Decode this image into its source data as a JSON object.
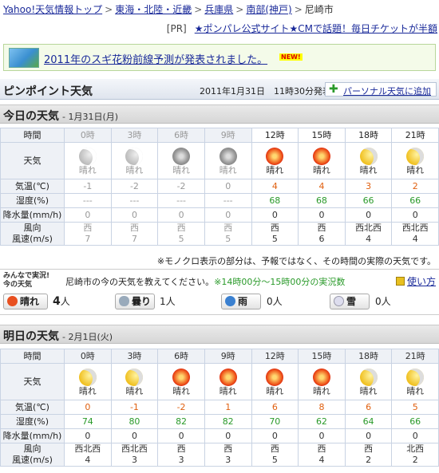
{
  "breadcrumb": {
    "items": [
      "Yahoo!天気情報トップ",
      "東海・北陸・近畿",
      "兵庫県",
      "南部(神戸)"
    ],
    "current": "尼崎市",
    "sep": ">"
  },
  "ad": {
    "tag": "[PR]",
    "text": "★ポンパレ公式サイト★CMで話題！毎日チケットが半額"
  },
  "banner": {
    "text": "2011年のスギ花粉前線予測が発表されました。",
    "new": "NEW!"
  },
  "pinpoint": {
    "title": "ピンポイント天気",
    "issued": "2011年1月31日　11時30分発表",
    "add_label": "パーソナル天気に追加",
    "add_icon": "plus-icon"
  },
  "today": {
    "title": "今日の天気",
    "date": "- 1月31日(月)",
    "row_labels": {
      "time": "時間",
      "weather": "天気",
      "temp": "気温(℃)",
      "humidity": "湿度(%)",
      "precip": "降水量(mm/h)",
      "wind_l1": "風向",
      "wind_l2": "風速(m/s)"
    },
    "times": [
      "0時",
      "3時",
      "6時",
      "9時",
      "12時",
      "15時",
      "18時",
      "21時"
    ],
    "weather": [
      "晴れ",
      "晴れ",
      "晴れ",
      "晴れ",
      "晴れ",
      "晴れ",
      "晴れ",
      "晴れ"
    ],
    "icons": [
      "moon-icon",
      "moon-icon",
      "sun-icon",
      "sun-icon",
      "sun-icon",
      "sun-icon",
      "moon-icon",
      "moon-icon"
    ],
    "temp": [
      "-1",
      "-2",
      "-2",
      "0",
      "4",
      "4",
      "3",
      "2"
    ],
    "humidity": [
      "---",
      "---",
      "---",
      "---",
      "68",
      "68",
      "66",
      "66"
    ],
    "precip": [
      "0",
      "0",
      "0",
      "0",
      "0",
      "0",
      "0",
      "0"
    ],
    "wind_dir": [
      "西",
      "西",
      "西",
      "西",
      "西",
      "西",
      "西北西",
      "西北西"
    ],
    "wind_speed": [
      "7",
      "7",
      "5",
      "5",
      "5",
      "6",
      "4",
      "4"
    ],
    "past_count": 4
  },
  "note": "※モノクロ表示の部分は、予報ではなく、その時間の実際の天気です。",
  "jikkyo": {
    "logo_l1": "みんなで実況!",
    "logo_l2": "今の天気",
    "prompt": "尼崎市の今の天気を教えてください。",
    "prompt_note": "※14時00分～15時00分の実況数",
    "howto": "使い方",
    "votes": [
      {
        "label": "晴れ",
        "count": "4",
        "unit": "人",
        "color": "#e85020"
      },
      {
        "label": "曇り",
        "count": "1",
        "unit": "人",
        "color": "#9ab"
      },
      {
        "label": "雨",
        "count": "0",
        "unit": "人",
        "color": "#3a80d0"
      },
      {
        "label": "雪",
        "count": "0",
        "unit": "人",
        "color": "#dde"
      }
    ]
  },
  "tomorrow": {
    "title": "明日の天気",
    "date": "- 2月1日(火)",
    "row_labels": {
      "time": "時間",
      "weather": "天気",
      "temp": "気温(℃)",
      "humidity": "湿度(%)",
      "precip": "降水量(mm/h)",
      "wind_l1": "風向",
      "wind_l2": "風速(m/s)"
    },
    "times": [
      "0時",
      "3時",
      "6時",
      "9時",
      "12時",
      "15時",
      "18時",
      "21時"
    ],
    "weather": [
      "晴れ",
      "晴れ",
      "晴れ",
      "晴れ",
      "晴れ",
      "晴れ",
      "晴れ",
      "晴れ"
    ],
    "icons": [
      "moon-icon",
      "moon-icon",
      "sun-icon",
      "sun-icon",
      "sun-icon",
      "sun-icon",
      "moon-icon",
      "moon-icon"
    ],
    "temp": [
      "0",
      "-1",
      "-2",
      "1",
      "6",
      "8",
      "6",
      "5"
    ],
    "humidity": [
      "74",
      "80",
      "82",
      "82",
      "70",
      "62",
      "64",
      "66"
    ],
    "precip": [
      "0",
      "0",
      "0",
      "0",
      "0",
      "0",
      "0",
      "0"
    ],
    "wind_dir": [
      "西北西",
      "西北西",
      "西",
      "西",
      "西",
      "西",
      "西",
      "北西"
    ],
    "wind_speed": [
      "4",
      "3",
      "3",
      "3",
      "5",
      "4",
      "2",
      "2"
    ],
    "past_count": 0
  }
}
